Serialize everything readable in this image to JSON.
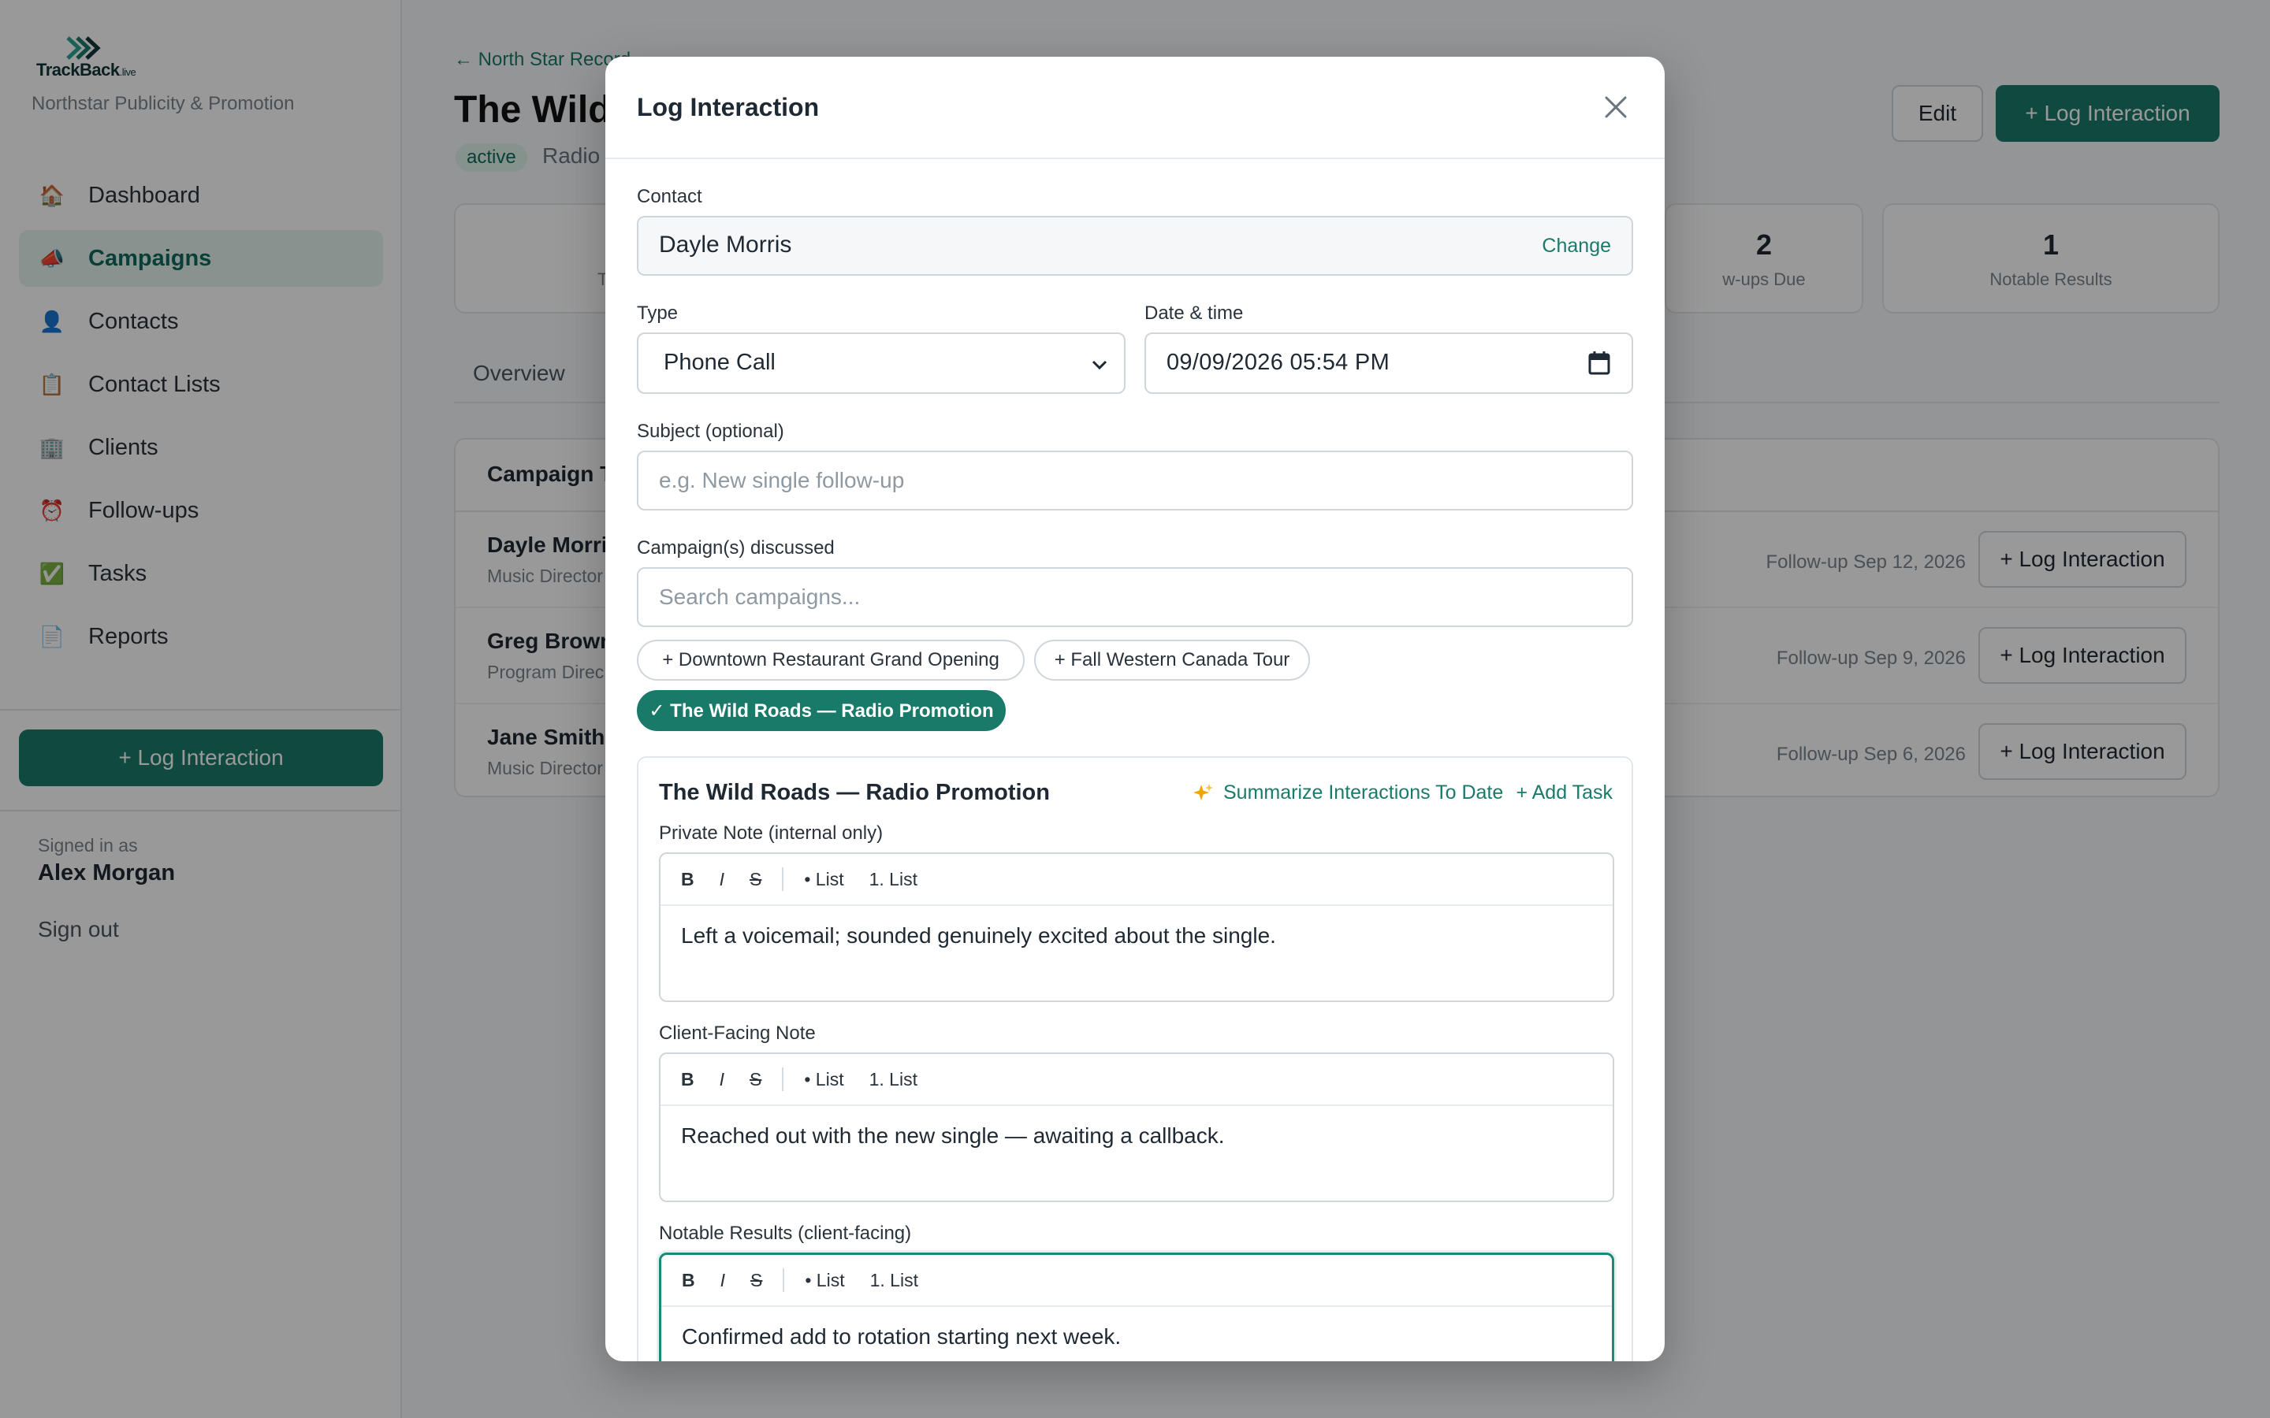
{
  "app": {
    "logo_text": "TrackBack",
    "logo_suffix": ".live",
    "org_name": "Northstar Publicity & Promotion",
    "accent_color": "#1a7a6a"
  },
  "sidebar": {
    "items": [
      {
        "label": "Dashboard",
        "icon": "house-icon",
        "active": false
      },
      {
        "label": "Campaigns",
        "icon": "megaphone-icon",
        "active": true
      },
      {
        "label": "Contacts",
        "icon": "person-icon",
        "active": false
      },
      {
        "label": "Contact Lists",
        "icon": "clipboard-icon",
        "active": false
      },
      {
        "label": "Clients",
        "icon": "building-icon",
        "active": false
      },
      {
        "label": "Follow-ups",
        "icon": "alarm-clock-icon",
        "active": false
      },
      {
        "label": "Tasks",
        "icon": "checkbox-icon",
        "active": false
      },
      {
        "label": "Reports",
        "icon": "document-icon",
        "active": false
      }
    ],
    "cta_label": "+ Log Interaction",
    "signed_in_label": "Signed in as",
    "user_name": "Alex Morgan",
    "sign_out_label": "Sign out"
  },
  "page": {
    "back_link": "← North Star Record",
    "title": "The Wild",
    "status_badge": "active",
    "type_label": "Radio",
    "edit_label": "Edit",
    "log_label": "+ Log Interaction",
    "stats": [
      {
        "num": "",
        "label": "To"
      },
      {
        "num": "2",
        "label": "w-ups Due"
      },
      {
        "num": "1",
        "label": "Notable Results"
      }
    ],
    "tabs": [
      {
        "label": "Overview"
      }
    ],
    "table": {
      "heading": "Campaign T",
      "rows": [
        {
          "name": "Dayle Morri",
          "role": "Music Director",
          "followup": "Follow-up Sep 12, 2026",
          "action": "+ Log Interaction"
        },
        {
          "name": "Greg Brown",
          "role": "Program Direc",
          "followup": "Follow-up Sep 9, 2026",
          "action": "+ Log Interaction"
        },
        {
          "name": "Jane Smith",
          "role": "Music Director",
          "followup": "Follow-up Sep 6, 2026",
          "action": "+ Log Interaction"
        }
      ]
    }
  },
  "modal": {
    "title": "Log Interaction",
    "contact_label": "Contact",
    "contact_value": "Dayle Morris",
    "change_label": "Change",
    "type_label": "Type",
    "type_value": "Phone Call",
    "datetime_label": "Date & time",
    "datetime_value": "09/09/2026 05:54 PM",
    "subject_label": "Subject (optional)",
    "subject_placeholder": "e.g. New single follow-up",
    "campaigns_label": "Campaign(s) discussed",
    "campaigns_placeholder": "Search campaigns...",
    "chips": [
      {
        "label": "+ Downtown Restaurant Grand Opening",
        "selected": false
      },
      {
        "label": "+ Fall Western Canada Tour",
        "selected": false
      },
      {
        "label": "✓ The Wild Roads — Radio Promotion",
        "selected": true
      }
    ],
    "section": {
      "title": "The Wild Roads — Radio Promotion",
      "summarize_label": "Summarize Interactions To Date",
      "add_task_label": "+ Add Task",
      "toolbar": {
        "bold": "B",
        "italic": "I",
        "strike": "S",
        "bullet": "• List",
        "numbered": "1. List"
      },
      "private_label": "Private Note (internal only)",
      "private_text": "Left a voicemail; sounded genuinely excited about the single.",
      "client_label": "Client-Facing Note",
      "client_text": "Reached out with the new single — awaiting a callback.",
      "notable_label": "Notable Results (client-facing)",
      "notable_text": "Confirmed add to rotation starting next week."
    }
  }
}
